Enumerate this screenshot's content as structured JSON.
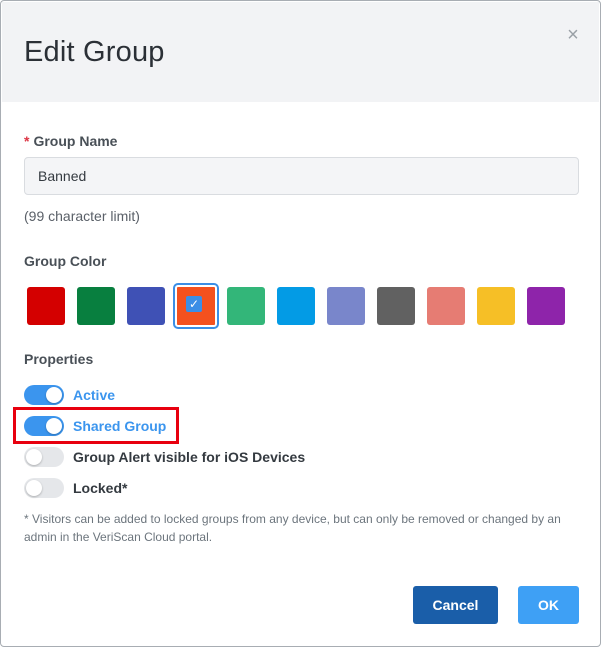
{
  "dialog": {
    "title": "Edit Group",
    "close_symbol": "×"
  },
  "group_name": {
    "required_marker": "*",
    "label": "Group Name",
    "value": "Banned",
    "hint": "(99 character limit)"
  },
  "group_color": {
    "label": "Group Color",
    "selected_index": 3,
    "check_symbol": "✓",
    "swatches": [
      "#d40000",
      "#087f3f",
      "#3f51b5",
      "#f4511e",
      "#33b679",
      "#039be5",
      "#7986cb",
      "#616161",
      "#e67c73",
      "#f6bf26",
      "#8e24aa"
    ]
  },
  "properties": {
    "label": "Properties",
    "toggles": [
      {
        "label": "Active",
        "on": true
      },
      {
        "label": "Shared Group",
        "on": true
      },
      {
        "label": "Group Alert visible for iOS Devices",
        "on": false
      },
      {
        "label": "Locked*",
        "on": false
      }
    ],
    "note": "* Visitors can be added to locked groups from any device, but can only be removed or changed by an admin in the VeriScan Cloud portal."
  },
  "footer": {
    "cancel_label": "Cancel",
    "ok_label": "OK"
  },
  "colors": {
    "accent": "#3b95ee",
    "highlight": "#e8000f",
    "cancel_bg": "#1a5ea9",
    "ok_bg": "#3ea0f5"
  }
}
